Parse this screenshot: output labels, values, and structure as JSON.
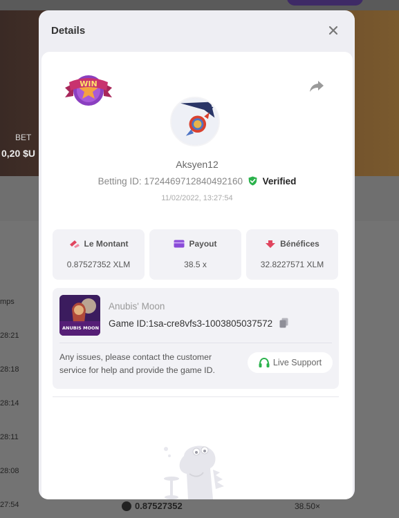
{
  "background": {
    "bet_label": "BET",
    "bet_value": "0,20 $U",
    "column_header": "mps",
    "times": [
      "28:21",
      "28:18",
      "28:14",
      "28:11",
      "28:08",
      "27:54"
    ],
    "bottom_amount": "0.87527352",
    "bottom_multiplier": "38.50×"
  },
  "modal": {
    "title": "Details",
    "close_icon": "close-icon"
  },
  "bet": {
    "badge": "WIN",
    "username": "Aksyen12",
    "betting_id_label": "Betting ID:",
    "betting_id": "1724469712840492160",
    "verified_label": "Verified",
    "timestamp": "11/02/2022, 13:27:54"
  },
  "stats": [
    {
      "label": "Le Montant",
      "value": "0.87527352 XLM",
      "icon": "coins-icon",
      "color": "#e0455e"
    },
    {
      "label": "Payout",
      "value": "38.5 x",
      "icon": "card-icon",
      "color": "#8a4bd8"
    },
    {
      "label": "Bénéfices",
      "value": "32.8227571 XLM",
      "icon": "profit-icon",
      "color": "#e0455e"
    }
  ],
  "game": {
    "name": "Anubis' Moon",
    "game_id_label": "Game ID:",
    "game_id": "1sa-cre8vfs3-1003805037572",
    "thumb_text": "ANUBIS MOON",
    "support_text": "Any issues, please contact the customer service for help and provide the game ID.",
    "live_support_label": "Live Support"
  },
  "colors": {
    "verified": "#2bb24c",
    "support_icon": "#2bb24c",
    "badge_ribbon": "#c8336e",
    "badge_star": "#f4a340"
  }
}
